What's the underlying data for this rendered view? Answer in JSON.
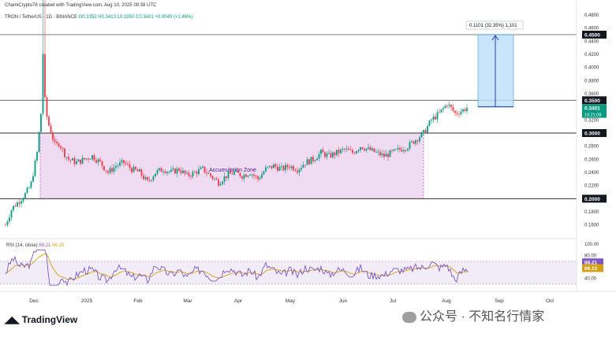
{
  "header": {
    "line1": "ChamiCrypto78 created with TradingView.com, Aug 10, 2025 09:38 UTC",
    "symbol": "TRON / TetherUS · 1D · BINANCE",
    "ohlc": "O0.3352 H0.3413 L0.3350 C0.3401 +0.0049 (+1.46%)"
  },
  "price_axis": {
    "ticks": [
      "0.4800",
      "0.4600",
      "0.4400",
      "0.4200",
      "0.4000",
      "0.3800",
      "0.3600",
      "0.3400",
      "0.3200",
      "0.2800",
      "0.2600",
      "0.2400",
      "0.2200",
      "0.1800",
      "0.1600"
    ],
    "badges": {
      "resistance_top": "0.4500",
      "resistance": "0.3500",
      "current_price": "0.3401",
      "countdown": "14:21:08",
      "support_top": "0.3000",
      "support_bottom": "0.2000"
    }
  },
  "annotations": {
    "zone_label": "Accumulation Zone",
    "measure_label": "0.1101 (32.35%) 1,101"
  },
  "rsi": {
    "label": "RSI (14, close)",
    "rsi_value": "68.21",
    "ma_value": "66.15",
    "ticks": [
      "100.00",
      "80.00",
      "40.00"
    ]
  },
  "time_axis": [
    "Dec",
    "2025",
    "Feb",
    "Mar",
    "Apr",
    "May",
    "Jun",
    "Jul",
    "Aug",
    "Sep",
    "Oct"
  ],
  "footer": {
    "logo": "TradingView",
    "watermark": "公众号 · 不知名行情家"
  },
  "colors": {
    "up": "#089981",
    "down": "#f23645",
    "zone": "#e1bee7",
    "measure": "#bbdefb",
    "rsi": "#7e57c2",
    "rsi_ma": "#d4a017"
  },
  "chart_data": {
    "type": "candlestick",
    "xlabel": "",
    "ylabel": "",
    "ylim": [
      0.15,
      0.49
    ],
    "annotations": [
      {
        "type": "zone",
        "label": "Accumulation Zone",
        "from": "Dec",
        "to": "Jul",
        "top": 0.3,
        "bottom": 0.2
      },
      {
        "type": "hline",
        "value": 0.45
      },
      {
        "type": "hline",
        "value": 0.35
      },
      {
        "type": "hline",
        "value": 0.3
      },
      {
        "type": "hline",
        "value": 0.2
      },
      {
        "type": "measure",
        "label": "0.1101 (32.35%) 1,101",
        "from": 0.34,
        "to": 0.45
      }
    ],
    "series": [
      {
        "name": "TRON / TetherUS",
        "close_path": [
          [
            0,
            0.16
          ],
          [
            8,
            0.185
          ],
          [
            16,
            0.195
          ],
          [
            24,
            0.205
          ],
          [
            32,
            0.22
          ],
          [
            40,
            0.27
          ],
          [
            45,
            0.33
          ],
          [
            48,
            0.44
          ],
          [
            50,
            0.35
          ],
          [
            53,
            0.32
          ],
          [
            58,
            0.3
          ],
          [
            63,
            0.28
          ],
          [
            68,
            0.285
          ],
          [
            74,
            0.27
          ],
          [
            80,
            0.26
          ],
          [
            90,
            0.255
          ],
          [
            100,
            0.26
          ],
          [
            110,
            0.265
          ],
          [
            120,
            0.255
          ],
          [
            130,
            0.24
          ],
          [
            140,
            0.25
          ],
          [
            150,
            0.255
          ],
          [
            160,
            0.245
          ],
          [
            170,
            0.24
          ],
          [
            180,
            0.225
          ],
          [
            190,
            0.24
          ],
          [
            200,
            0.245
          ],
          [
            210,
            0.24
          ],
          [
            220,
            0.245
          ],
          [
            230,
            0.235
          ],
          [
            240,
            0.24
          ],
          [
            250,
            0.245
          ],
          [
            260,
            0.235
          ],
          [
            270,
            0.225
          ],
          [
            280,
            0.235
          ],
          [
            290,
            0.24
          ],
          [
            300,
            0.235
          ],
          [
            310,
            0.24
          ],
          [
            320,
            0.23
          ],
          [
            330,
            0.245
          ],
          [
            340,
            0.25
          ],
          [
            350,
            0.245
          ],
          [
            360,
            0.25
          ],
          [
            370,
            0.245
          ],
          [
            380,
            0.255
          ],
          [
            390,
            0.26
          ],
          [
            400,
            0.27
          ],
          [
            410,
            0.265
          ],
          [
            420,
            0.27
          ],
          [
            430,
            0.275
          ],
          [
            440,
            0.27
          ],
          [
            450,
            0.28
          ],
          [
            460,
            0.275
          ],
          [
            470,
            0.27
          ],
          [
            480,
            0.265
          ],
          [
            490,
            0.27
          ],
          [
            500,
            0.275
          ],
          [
            510,
            0.28
          ],
          [
            520,
            0.29
          ],
          [
            530,
            0.3
          ],
          [
            540,
            0.32
          ],
          [
            550,
            0.33
          ],
          [
            560,
            0.345
          ],
          [
            570,
            0.33
          ],
          [
            580,
            0.335
          ],
          [
            587,
            0.34
          ]
        ]
      }
    ],
    "rsi": {
      "name": "RSI (14, close)",
      "last": 68.21,
      "ma_last": 66.15
    }
  }
}
